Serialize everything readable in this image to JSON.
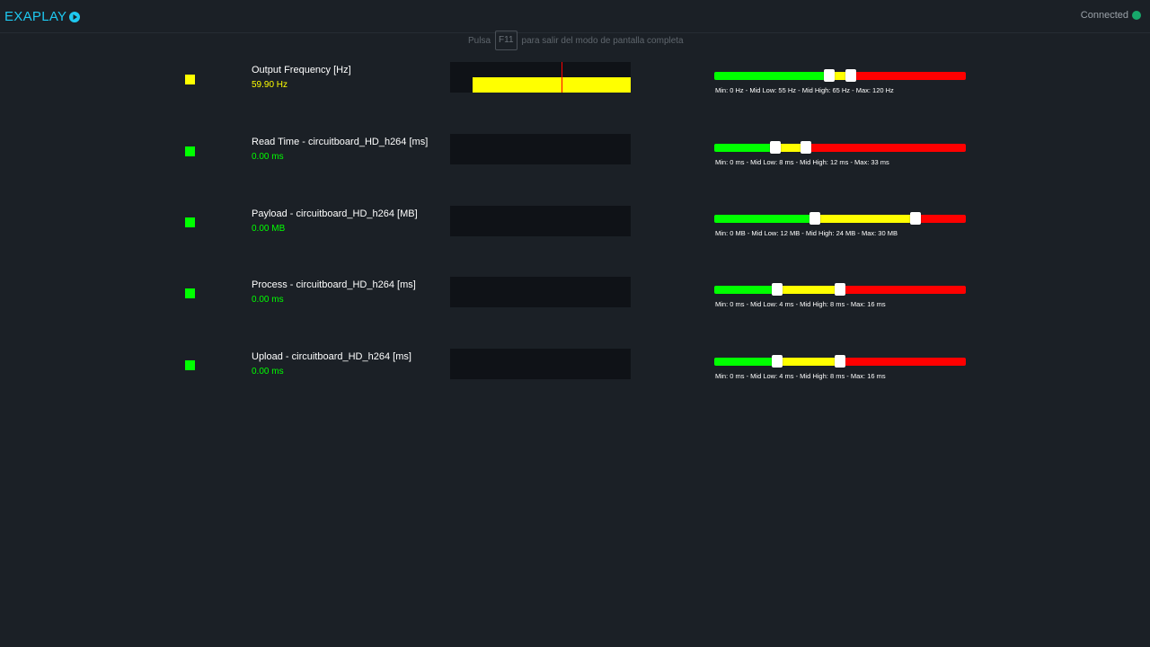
{
  "header": {
    "brand": "EXAPLAY",
    "status": "Connected",
    "status_color": "#17a86b"
  },
  "fullscreen_hint": {
    "prefix": "Pulsa",
    "key": "F11",
    "suffix": "para salir del modo de pantalla completa"
  },
  "colors": {
    "green": "#00ff00",
    "yellow": "#ffff00",
    "red": "#ff0000",
    "graph_bg": "#0f1217"
  },
  "metrics": [
    {
      "label": "Output Frequency [Hz]",
      "value": "59.90 Hz",
      "status_color": "#ffff00",
      "min": 0,
      "mid_low": 55,
      "mid_high": 65,
      "max": 120,
      "current": 59.9,
      "range_text": "Min: 0 Hz - Mid Low: 55 Hz - Mid High: 65 Hz - Max: 120 Hz"
    },
    {
      "label": "Read Time - circuitboard_HD_h264 [ms]",
      "value": "0.00 ms",
      "status_color": "#00ff00",
      "min": 0,
      "mid_low": 8,
      "mid_high": 12,
      "max": 33,
      "current": 0,
      "range_text": "Min: 0 ms - Mid Low: 8 ms - Mid High: 12 ms - Max: 33 ms"
    },
    {
      "label": "Payload - circuitboard_HD_h264 [MB]",
      "value": "0.00 MB",
      "status_color": "#00ff00",
      "min": 0,
      "mid_low": 12,
      "mid_high": 24,
      "max": 30,
      "current": 0,
      "range_text": "Min: 0 MB - Mid Low: 12 MB - Mid High: 24 MB - Max: 30 MB"
    },
    {
      "label": "Process - circuitboard_HD_h264 [ms]",
      "value": "0.00 ms",
      "status_color": "#00ff00",
      "min": 0,
      "mid_low": 4,
      "mid_high": 8,
      "max": 16,
      "current": 0,
      "range_text": "Min: 0 ms - Mid Low: 4 ms - Mid High: 8 ms - Max: 16 ms"
    },
    {
      "label": "Upload - circuitboard_HD_h264 [ms]",
      "value": "0.00 ms",
      "status_color": "#00ff00",
      "min": 0,
      "mid_low": 4,
      "mid_high": 8,
      "max": 16,
      "current": 0,
      "range_text": "Min: 0 ms - Mid Low: 4 ms - Mid High: 8 ms - Max: 16 ms"
    }
  ]
}
